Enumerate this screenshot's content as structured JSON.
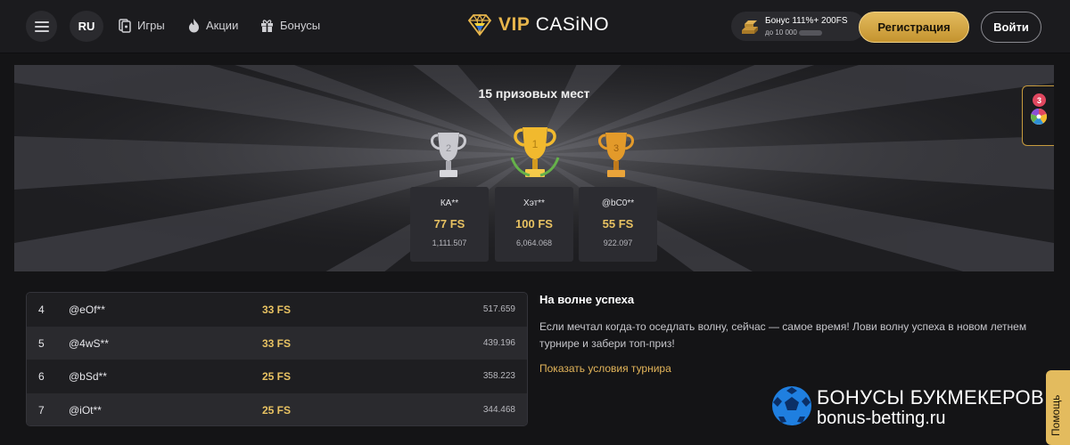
{
  "header": {
    "lang": "RU",
    "nav": [
      {
        "label": "Игры",
        "icon": "games-icon"
      },
      {
        "label": "Акции",
        "icon": "flame-icon"
      },
      {
        "label": "Бонусы",
        "icon": "gift-icon"
      }
    ],
    "logo": {
      "vip": "VIP",
      "casino": "CASiNO"
    },
    "bonus": {
      "line1": "Бонус 111%+ 200FS",
      "line2": "до 10 000"
    },
    "register_label": "Регистрация",
    "login_label": "Войти"
  },
  "hero": {
    "title": "15 призовых мест",
    "podium": [
      {
        "place": "2",
        "name": "КА**",
        "fs": "77 FS",
        "points": "1,111.507",
        "trophy_color": "#c9c9cf"
      },
      {
        "place": "1",
        "name": "Хэт**",
        "fs": "100 FS",
        "points": "6,064.068",
        "trophy_color": "#f1b92e"
      },
      {
        "place": "3",
        "name": "@bC0**",
        "fs": "55 FS",
        "points": "922.097",
        "trophy_color": "#e39a2a"
      }
    ]
  },
  "side_widget": {
    "badge": "3",
    "icon": "fortune-wheel-icon"
  },
  "leaderboard": [
    {
      "rank": "4",
      "user": "@eOf**",
      "fs": "33 FS",
      "points": "517.659"
    },
    {
      "rank": "5",
      "user": "@4wS**",
      "fs": "33 FS",
      "points": "439.196"
    },
    {
      "rank": "6",
      "user": "@bSd**",
      "fs": "25 FS",
      "points": "358.223"
    },
    {
      "rank": "7",
      "user": "@iOt**",
      "fs": "25 FS",
      "points": "344.468"
    }
  ],
  "description": {
    "title": "На волне успеха",
    "text": "Если мечтал когда-то оседлать волну, сейчас — самое время! Лови волну успеха в новом летнем турнире и забери топ-приз!",
    "link": "Показать условия турнира"
  },
  "watermark": {
    "line1": "БОНУСЫ БУКМЕКЕРОВ",
    "line2": "bonus-betting.ru"
  },
  "help_label": "Помощь",
  "colors": {
    "accent": "#e3bb5e",
    "background": "#141416",
    "panel": "#1e1e21",
    "badge": "#e0475f"
  }
}
